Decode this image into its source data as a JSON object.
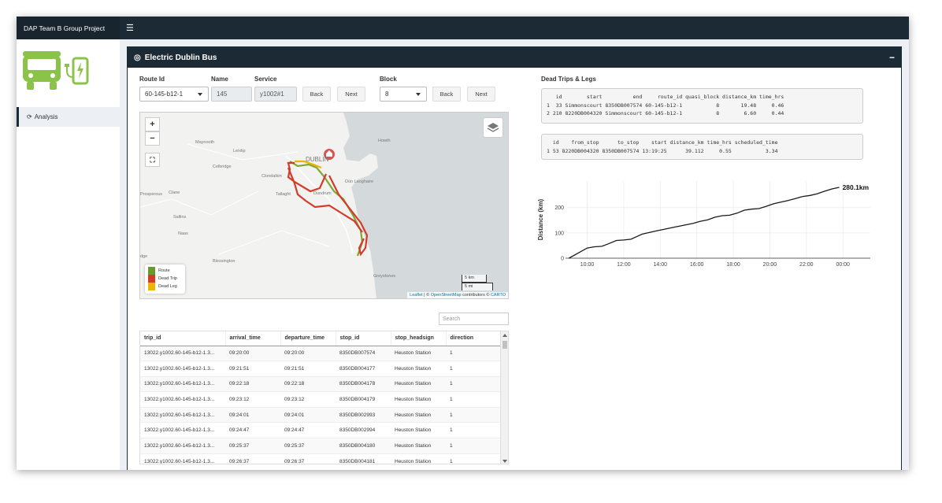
{
  "app": {
    "title": "DAP Team B Group Project"
  },
  "sidebar": {
    "items": [
      {
        "label": "Analysis"
      }
    ]
  },
  "box": {
    "title": "Electric Dublin Bus"
  },
  "controls": {
    "route_label": "Route Id",
    "route_value": "60-145-b12-1",
    "name_label": "Name",
    "name_value": "145",
    "service_label": "Service",
    "service_value": "y1002#1",
    "back1": "Back",
    "next1": "Next",
    "block_label": "Block",
    "block_value": "8",
    "back2": "Back",
    "next2": "Next"
  },
  "map": {
    "zoom_in": "+",
    "zoom_out": "−",
    "places": [
      "Maynooth",
      "Howth",
      "Leixlip",
      "DUBLIN",
      "Celbridge",
      "Clondalkin",
      "Dún Laoghaire",
      "Prosperous",
      "Clane",
      "Tallaght",
      "Dundrum",
      "Sallins",
      "Naas",
      "Blessington",
      "Greystones",
      "dge"
    ],
    "legend": [
      {
        "label": "Route",
        "color": "#6a9a2e"
      },
      {
        "label": "Dead Trip",
        "color": "#d43b2a"
      },
      {
        "label": "Dead Leg",
        "color": "#f0b400"
      }
    ],
    "scale_km": "5 km",
    "scale_mi": "5 mi",
    "attrib_leaflet": "Leaflet",
    "attrib_sep": " | © ",
    "attrib_osm": "OpenStreetMap",
    "attrib_mid": " contributors © ",
    "attrib_carto": "CARTO"
  },
  "table": {
    "search_placeholder": "Search",
    "headers": [
      "trip_id",
      "arrival_time",
      "departure_time",
      "stop_id",
      "stop_headsign",
      "direction"
    ],
    "rows": [
      [
        "13022.y1002.60-145-b12-1.3...",
        "09:20:00",
        "09:20:00",
        "8350DB007574",
        "Heuston Station",
        "1"
      ],
      [
        "13022.y1002.60-145-b12-1.3...",
        "09:21:51",
        "09:21:51",
        "8350DB004177",
        "Heuston Station",
        "1"
      ],
      [
        "13022.y1002.60-145-b12-1.3...",
        "09:22:18",
        "09:22:18",
        "8350DB004178",
        "Heuston Station",
        "1"
      ],
      [
        "13022.y1002.60-145-b12-1.3...",
        "09:23:12",
        "09:23:12",
        "8350DB004179",
        "Heuston Station",
        "1"
      ],
      [
        "13022.y1002.60-145-b12-1.3...",
        "09:24:01",
        "09:24:01",
        "8350DB002993",
        "Heuston Station",
        "1"
      ],
      [
        "13022.y1002.60-145-b12-1.3...",
        "09:24:47",
        "09:24:47",
        "8350DB002994",
        "Heuston Station",
        "1"
      ],
      [
        "13022.y1002.60-145-b12-1.3...",
        "09:25:37",
        "09:25:37",
        "8350DB004180",
        "Heuston Station",
        "1"
      ],
      [
        "13022.y1002.60-145-b12-1.3...",
        "09:26:37",
        "09:26:37",
        "8350DB004181",
        "Heuston Station",
        "1"
      ]
    ]
  },
  "dead": {
    "title": "Dead Trips & Legs",
    "trips_text": "   id        start          end     route_id quasi_block distance_km time_hrs\n1  33 Simmonscourt 8350DB007574 60-145-b12-1           8       19.48     0.46\n2 210 8220DB004320 Simmonscourt 60-145-b12-1           8        6.60     0.44",
    "legs_text": "  id    from_stop      to_stop    start distance_km time_hrs scheduled_time\n1 53 8220DB004320 8350DB007574 13:19:25      39.112     0.55           3.34"
  },
  "chart_data": {
    "type": "line",
    "ylabel": "Distance (km)",
    "xlabel": "",
    "x_ticks": [
      "10:00",
      "12:00",
      "14:00",
      "16:00",
      "18:00",
      "20:00",
      "22:00",
      "00:00"
    ],
    "y_ticks": [
      0,
      100,
      200
    ],
    "x_hours": [
      9.0,
      9.5,
      10.0,
      10.4,
      10.8,
      11.1,
      11.6,
      12.0,
      12.4,
      12.7,
      13.0,
      13.3,
      13.8,
      14.2,
      14.6,
      15.0,
      15.4,
      15.8,
      16.2,
      16.6,
      17.0,
      17.4,
      17.8,
      18.2,
      18.6,
      19.0,
      19.4,
      19.8,
      20.2,
      20.6,
      21.0,
      21.4,
      21.8,
      22.2,
      22.6,
      23.0,
      23.4,
      23.8
    ],
    "y_km": [
      0,
      20,
      40,
      45,
      47,
      55,
      70,
      72,
      75,
      85,
      95,
      100,
      108,
      114,
      120,
      126,
      132,
      138,
      146,
      152,
      162,
      168,
      170,
      178,
      190,
      194,
      196,
      205,
      215,
      222,
      228,
      236,
      244,
      248,
      255,
      265,
      274,
      280.1
    ],
    "xlim": [
      8.9,
      25.5
    ],
    "ylim": [
      0,
      305
    ],
    "end_label": "280.1km"
  }
}
